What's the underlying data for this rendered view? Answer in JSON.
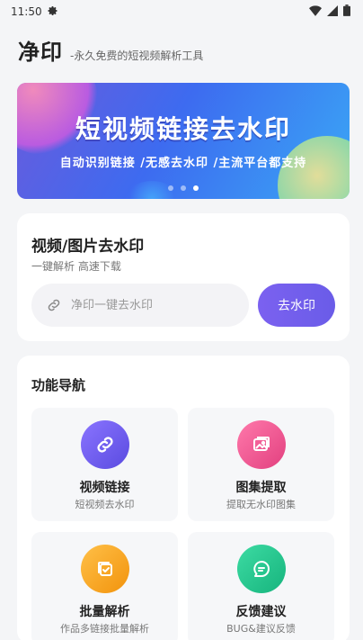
{
  "status_bar": {
    "time": "11:50",
    "icons": [
      "gear-icon",
      "wifi-icon",
      "signal-icon",
      "battery-icon"
    ]
  },
  "header": {
    "title": "净印",
    "subtitle": "-永久免费的短视频解析工具"
  },
  "banner": {
    "title": "短视频链接去水印",
    "subtitle": "自动识别链接 /无感去水印 /主流平台都支持",
    "slide_count": 3,
    "active_slide": 3
  },
  "remover_card": {
    "title": "视频/图片去水印",
    "subtitle": "一键解析 高速下载",
    "input_placeholder": "净印一键去水印",
    "input_value": "",
    "button_label": "去水印"
  },
  "nav": {
    "title": "功能导航",
    "items": [
      {
        "label": "视频链接",
        "desc": "短视频去水印",
        "icon": "link-icon",
        "color": "#6f5ee8"
      },
      {
        "label": "图集提取",
        "desc": "提取无水印图集",
        "icon": "gallery-icon",
        "color": "#ee4f8c"
      },
      {
        "label": "批量解析",
        "desc": "作品多链接批量解析",
        "icon": "batch-icon",
        "color": "#f6a21c"
      },
      {
        "label": "反馈建议",
        "desc": "BUG&建议反馈",
        "icon": "feedback-icon",
        "color": "#1fbf8a"
      }
    ]
  },
  "colors": {
    "accent": "#6f5ee8",
    "background": "#f4f5f7"
  }
}
